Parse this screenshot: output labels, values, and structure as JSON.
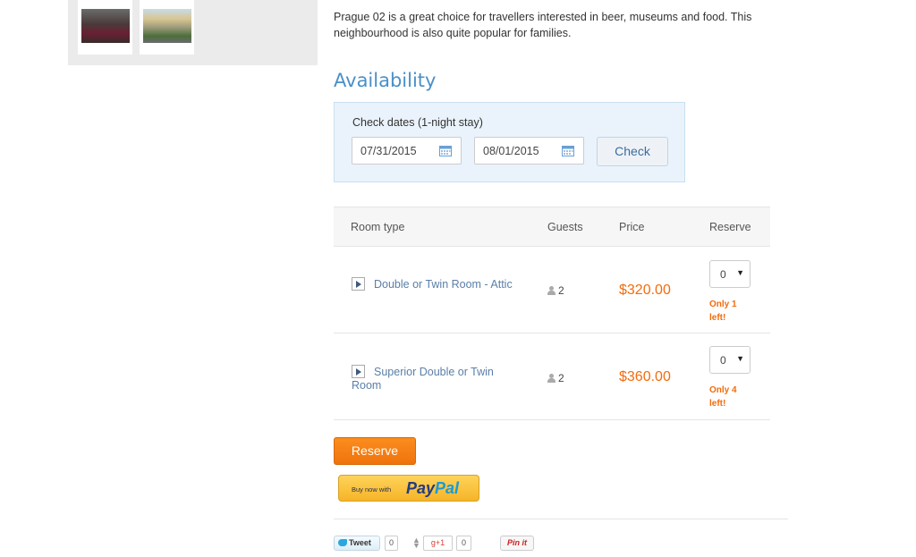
{
  "description": "Prague 02 is a great choice for travellers interested in beer, museums and food. This neighbourhood is also quite popular for families.",
  "availability": {
    "heading": "Availability",
    "check_label": "Check dates (1-night stay)",
    "checkin": "07/31/2015",
    "checkout": "08/01/2015",
    "check_button": "Check"
  },
  "rooms": {
    "headers": {
      "type": "Room type",
      "guests": "Guests",
      "price": "Price",
      "reserve": "Reserve"
    },
    "items": [
      {
        "name": "Double or Twin Room - Attic",
        "guests": "2",
        "price": "$320.00",
        "qty": "0",
        "availability_note": "Only 1 left!"
      },
      {
        "name": "Superior Double or Twin Room",
        "guests": "2",
        "price": "$360.00",
        "qty": "0",
        "availability_note": "Only 4 left!"
      }
    ]
  },
  "reserve_button": "Reserve",
  "paypal": {
    "small": "Buy now with",
    "brand_1": "Pay",
    "brand_2": "Pal"
  },
  "social": {
    "tweet": "Tweet",
    "tweet_count": "0",
    "gplus": "g+1",
    "gplus_count": "0",
    "pin": "Pin it"
  },
  "colors": {
    "accent_orange": "#f26c0d",
    "heading_blue": "#4a90c7",
    "link_blue": "#5a7fa8"
  }
}
